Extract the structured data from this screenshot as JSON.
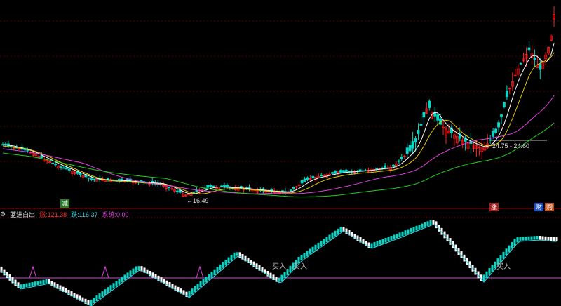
{
  "chart_data": [
    {
      "type": "candlestick",
      "title": "",
      "annotations": {
        "low_label": "16.49",
        "level_label": "24.75 - 24.60"
      },
      "series": [
        {
          "name": "",
          "role": "MA-short",
          "color": "#ffffff"
        },
        {
          "name": "",
          "role": "MA-mid",
          "color": "#e6c800"
        },
        {
          "name": "",
          "role": "MA-long",
          "color": "#e040e0"
        },
        {
          "name": "",
          "role": "MA-longest",
          "color": "#22cc22"
        }
      ],
      "bottom_markers": [
        "减",
        "涨",
        "财",
        "购"
      ]
    },
    {
      "type": "line",
      "indicator": {
        "name": "蓝进白出",
        "items": [
          {
            "label": "涨:",
            "value": "121.38",
            "color": "#ff3030"
          },
          {
            "label": "跌:",
            "value": "116.37",
            "color": "#3ad3e0"
          },
          {
            "label": "系统:",
            "value": "0.00",
            "color": "#e040e0"
          }
        ]
      },
      "signals": [
        "买入",
        "买入",
        "买入"
      ]
    }
  ],
  "colors": {
    "up": "#ff2020",
    "down": "#00d8c8",
    "grid": "#5a0000",
    "divider": "#a00000"
  }
}
